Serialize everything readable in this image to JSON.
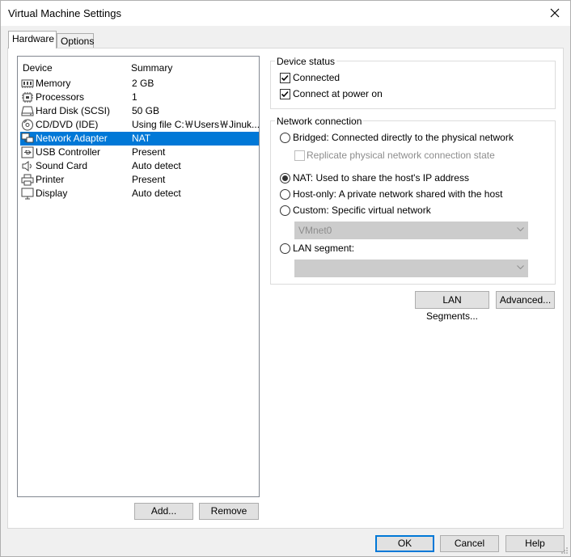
{
  "window": {
    "title": "Virtual Machine Settings"
  },
  "tabs": [
    {
      "label": "Hardware",
      "active": true
    },
    {
      "label": "Options",
      "active": false
    }
  ],
  "device_list": {
    "headers": {
      "device": "Device",
      "summary": "Summary"
    },
    "items": [
      {
        "device": "Memory",
        "summary": "2 GB",
        "icon": "memory-icon"
      },
      {
        "device": "Processors",
        "summary": "1",
        "icon": "processor-icon"
      },
      {
        "device": "Hard Disk (SCSI)",
        "summary": "50 GB",
        "icon": "hard-disk-icon"
      },
      {
        "device": "CD/DVD (IDE)",
        "summary": "Using file C:￦Users￦Jinuk...",
        "icon": "cd-dvd-icon"
      },
      {
        "device": "Network Adapter",
        "summary": "NAT",
        "icon": "network-adapter-icon",
        "selected": true
      },
      {
        "device": "USB Controller",
        "summary": "Present",
        "icon": "usb-icon"
      },
      {
        "device": "Sound Card",
        "summary": "Auto detect",
        "icon": "speaker-icon"
      },
      {
        "device": "Printer",
        "summary": "Present",
        "icon": "printer-icon"
      },
      {
        "device": "Display",
        "summary": "Auto detect",
        "icon": "monitor-icon"
      }
    ],
    "add_label": "Add...",
    "remove_label": "Remove"
  },
  "device_status": {
    "title": "Device status",
    "connected": {
      "label": "Connected",
      "checked": true
    },
    "connect_power_on": {
      "label": "Connect at power on",
      "checked": true
    }
  },
  "network_connection": {
    "title": "Network connection",
    "bridged": {
      "label": "Bridged: Connected directly to the physical network",
      "selected": false
    },
    "replicate": {
      "label": "Replicate physical network connection state",
      "checked": false,
      "enabled": false
    },
    "nat": {
      "label": "NAT: Used to share the host's IP address",
      "selected": true
    },
    "host_only": {
      "label": "Host-only: A private network shared with the host",
      "selected": false
    },
    "custom": {
      "label": "Custom: Specific virtual network",
      "selected": false
    },
    "custom_combo_value": "VMnet0",
    "lan_segment": {
      "label": "LAN segment:",
      "selected": false
    },
    "lan_combo_value": ""
  },
  "buttons": {
    "lan_segments": "LAN Segments...",
    "advanced": "Advanced...",
    "ok": "OK",
    "cancel": "Cancel",
    "help": "Help"
  },
  "colors": {
    "selection": "#0078d7",
    "accent": "#0078d7"
  }
}
